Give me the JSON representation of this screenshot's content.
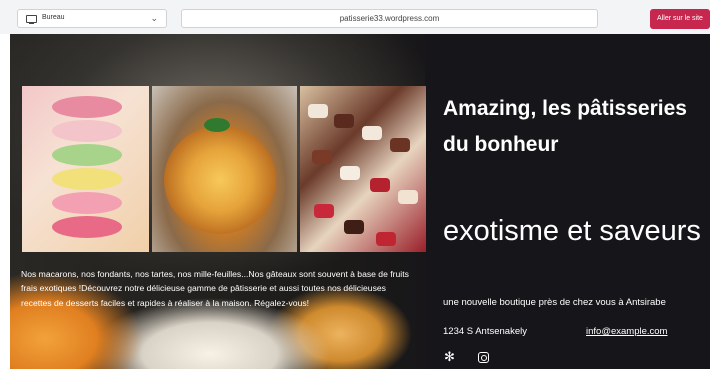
{
  "toolbar": {
    "device_label": "Bureau",
    "url": "patisserie33.wordpress.com",
    "cta_label": "Aller sur le site"
  },
  "hero": {
    "title": "Amazing, les pâtisseries du bonheur",
    "subtitle": "exotisme et saveurs",
    "description": "Nos macarons, nos fondants, nos tartes, nos mille-feuilles...Nos gâteaux sont souvent à base de fruits frais exotiques !Découvrez notre délicieuse gamme de pâtisserie et aussi toutes nos délicieuses recettes de desserts faciles et rapides à réaliser à la maison. Régalez-vous!",
    "tagline": "une nouvelle boutique près de chez vous à Antsirabe",
    "address": "1234 S Antsenakely",
    "email": "info@example.com"
  },
  "colors": {
    "accent": "#c7274f",
    "panel": "#161519"
  },
  "icons": {
    "device": "monitor-icon",
    "dropdown": "chevron-down-icon",
    "yelp": "yelp-icon",
    "instagram": "instagram-icon"
  }
}
